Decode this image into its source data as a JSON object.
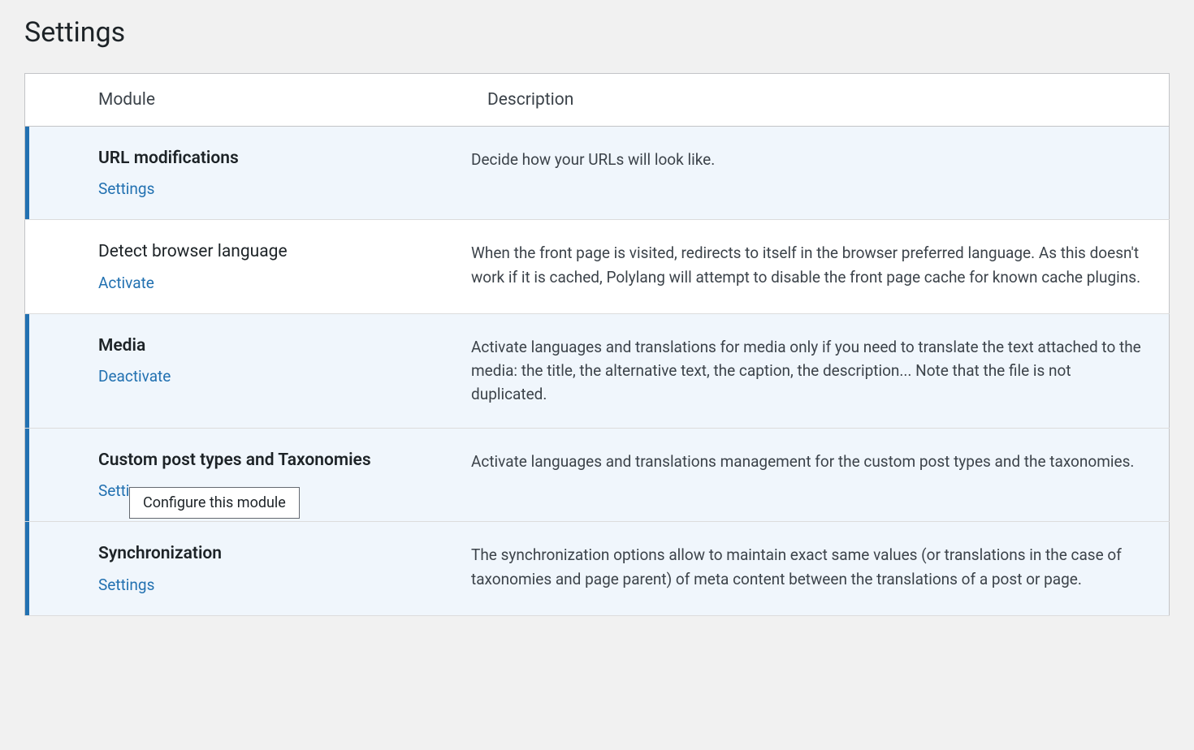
{
  "page": {
    "title": "Settings"
  },
  "table": {
    "headers": {
      "module": "Module",
      "description": "Description"
    },
    "rows": [
      {
        "title": "URL modifications",
        "action": "Settings",
        "description": "Decide how your URLs will look like.",
        "active": true,
        "bold": true
      },
      {
        "title": "Detect browser language",
        "action": "Activate",
        "description": "When the front page is visited, redirects to itself in the browser preferred language. As this doesn't work if it is cached, Polylang will attempt to disable the front page cache for known cache plugins.",
        "active": false,
        "bold": false
      },
      {
        "title": "Media",
        "action": "Deactivate",
        "description": "Activate languages and translations for media only if you need to translate the text attached to the media: the title, the alternative text, the caption, the description... Note that the file is not duplicated.",
        "active": true,
        "bold": true
      },
      {
        "title": "Custom post types and Taxonomies",
        "action": "Settings",
        "description": "Activate languages and translations management for the custom post types and the taxonomies.",
        "active": true,
        "bold": true
      },
      {
        "title": "Synchronization",
        "action": "Settings",
        "description": "The synchronization options allow to maintain exact same values (or translations in the case of taxonomies and page parent) of meta content between the translations of a post or page.",
        "active": true,
        "bold": true
      }
    ]
  },
  "tooltip": {
    "text": "Configure this module"
  }
}
